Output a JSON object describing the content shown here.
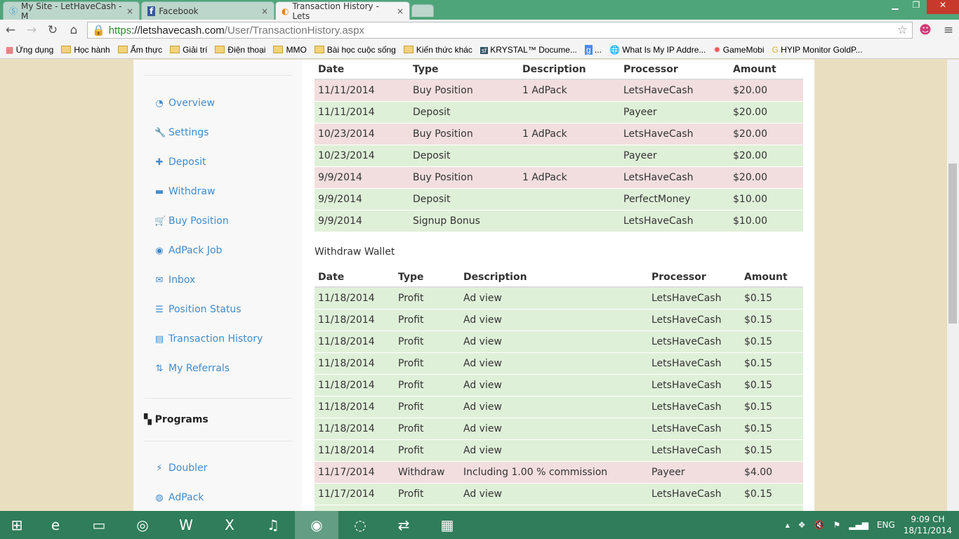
{
  "browser": {
    "tabs": [
      {
        "title": "My Site - LetHaveCash - M",
        "icon": "dollar-icon"
      },
      {
        "title": "Facebook",
        "icon": "facebook-icon"
      },
      {
        "title": "Transaction History - Lets",
        "icon": "globe-icon",
        "active": true
      }
    ],
    "url_scheme": "https",
    "url_host": "://letshavecash.com",
    "url_path": "/User/TransactionHistory.aspx",
    "bookmarks": [
      "Ứng dụng",
      "Học hành",
      "Ẩm thực",
      "Giải trí",
      "Điện thoại",
      "MMO",
      "Bài học cuộc sống",
      "Kiến thức khác",
      "KRYSTAL™ Docume...",
      "...",
      "What Is My IP Addre...",
      "GameMobi",
      "HYIP Monitor GoldP..."
    ]
  },
  "sidebar": {
    "items": [
      {
        "label": "Overview",
        "icon": "dashboard-icon",
        "g": "◔"
      },
      {
        "label": "Settings",
        "icon": "wrench-icon",
        "g": "🔧"
      },
      {
        "label": "Deposit",
        "icon": "plus-icon",
        "g": "✚"
      },
      {
        "label": "Withdraw",
        "icon": "minus-icon",
        "g": "▬"
      },
      {
        "label": "Buy Position",
        "icon": "cart-icon",
        "g": "🛒"
      },
      {
        "label": "AdPack Job",
        "icon": "eye-icon",
        "g": "◉"
      },
      {
        "label": "Inbox",
        "icon": "envelope-icon",
        "g": "✉"
      },
      {
        "label": "Position Status",
        "icon": "list-icon",
        "g": "☰"
      },
      {
        "label": "Transaction History",
        "icon": "list-alt-icon",
        "g": "▤"
      },
      {
        "label": "My Referrals",
        "icon": "sort-icon",
        "g": "⇅"
      }
    ],
    "programs_heading": "Programs",
    "programs": [
      {
        "label": "Doubler",
        "icon": "flash-icon",
        "g": "⚡"
      },
      {
        "label": "AdPack",
        "icon": "globe-icon",
        "g": "◍"
      }
    ]
  },
  "deposit_table": {
    "headers": [
      "Date",
      "Type",
      "Description",
      "Processor",
      "Amount"
    ],
    "rows": [
      {
        "c": "r",
        "v": [
          "11/11/2014",
          "Buy Position",
          "1 AdPack",
          "LetsHaveCash",
          "$20.00"
        ]
      },
      {
        "c": "g",
        "v": [
          "11/11/2014",
          "Deposit",
          "",
          "Payeer",
          "$20.00"
        ]
      },
      {
        "c": "r",
        "v": [
          "10/23/2014",
          "Buy Position",
          "1 AdPack",
          "LetsHaveCash",
          "$20.00"
        ]
      },
      {
        "c": "g",
        "v": [
          "10/23/2014",
          "Deposit",
          "",
          "Payeer",
          "$20.00"
        ]
      },
      {
        "c": "r",
        "v": [
          "9/9/2014",
          "Buy Position",
          "1 AdPack",
          "LetsHaveCash",
          "$20.00"
        ]
      },
      {
        "c": "g",
        "v": [
          "9/9/2014",
          "Deposit",
          "",
          "PerfectMoney",
          "$10.00"
        ]
      },
      {
        "c": "g",
        "v": [
          "9/9/2014",
          "Signup Bonus",
          "",
          "LetsHaveCash",
          "$10.00"
        ]
      }
    ]
  },
  "withdraw_wallet_label": "Withdraw Wallet",
  "withdraw_table": {
    "headers": [
      "Date",
      "Type",
      "Description",
      "Processor",
      "Amount"
    ],
    "rows": [
      {
        "c": "g",
        "v": [
          "11/18/2014",
          "Profit",
          "Ad view",
          "LetsHaveCash",
          "$0.15"
        ]
      },
      {
        "c": "g",
        "v": [
          "11/18/2014",
          "Profit",
          "Ad view",
          "LetsHaveCash",
          "$0.15"
        ]
      },
      {
        "c": "g",
        "v": [
          "11/18/2014",
          "Profit",
          "Ad view",
          "LetsHaveCash",
          "$0.15"
        ]
      },
      {
        "c": "g",
        "v": [
          "11/18/2014",
          "Profit",
          "Ad view",
          "LetsHaveCash",
          "$0.15"
        ]
      },
      {
        "c": "g",
        "v": [
          "11/18/2014",
          "Profit",
          "Ad view",
          "LetsHaveCash",
          "$0.15"
        ]
      },
      {
        "c": "g",
        "v": [
          "11/18/2014",
          "Profit",
          "Ad view",
          "LetsHaveCash",
          "$0.15"
        ]
      },
      {
        "c": "g",
        "v": [
          "11/18/2014",
          "Profit",
          "Ad view",
          "LetsHaveCash",
          "$0.15"
        ]
      },
      {
        "c": "g",
        "v": [
          "11/18/2014",
          "Profit",
          "Ad view",
          "LetsHaveCash",
          "$0.15"
        ]
      },
      {
        "c": "r",
        "v": [
          "11/17/2014",
          "Withdraw",
          "Including 1.00 % commission",
          "Payeer",
          "$4.00"
        ]
      },
      {
        "c": "g",
        "v": [
          "11/17/2014",
          "Profit",
          "Ad view",
          "LetsHaveCash",
          "$0.15"
        ]
      },
      {
        "c": "g",
        "v": [
          "",
          "",
          "",
          "",
          ""
        ]
      }
    ]
  },
  "taskbar": {
    "apps": [
      {
        "n": "start-icon",
        "g": "⊞"
      },
      {
        "n": "ie-icon",
        "g": "e"
      },
      {
        "n": "explorer-icon",
        "g": "▭"
      },
      {
        "n": "app-icon",
        "g": "◎"
      },
      {
        "n": "word-icon",
        "g": "W"
      },
      {
        "n": "excel-icon",
        "g": "X"
      },
      {
        "n": "itunes-icon",
        "g": "♫"
      },
      {
        "n": "chrome-icon",
        "g": "◉"
      },
      {
        "n": "browser-icon",
        "g": "◌"
      },
      {
        "n": "teamviewer-icon",
        "g": "⇄"
      },
      {
        "n": "calculator-icon",
        "g": "▦"
      }
    ],
    "lang": "ENG",
    "time": "9:09 CH",
    "date": "18/11/2014"
  }
}
